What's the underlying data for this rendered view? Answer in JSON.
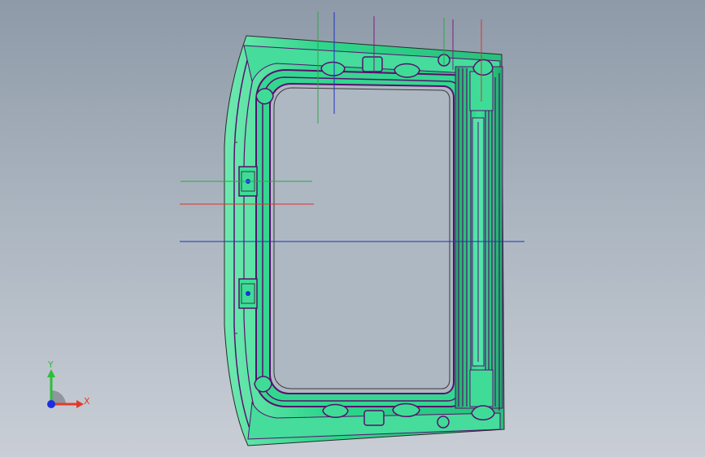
{
  "viewport": {
    "name": "3d-model-viewport",
    "background_top": "#8e9aa8",
    "background_bottom": "#c9ced6"
  },
  "model": {
    "name": "window-frame-part",
    "body_color": "#2fd68c",
    "body_light_color": "#6fe8b0",
    "edge_color": "#5a0f6e",
    "outline_color": "#2a2a2a"
  },
  "reference_lines": {
    "x_axis_color": "#e03030",
    "y_axis_color": "#2aa84a",
    "z_axis_color": "#2030c0",
    "extra_color": "#7a2080"
  },
  "triad": {
    "y_label": "Y",
    "x_label": "X",
    "y_color": "#2bbf3a",
    "x_color": "#e23a2a",
    "z_color": "#1b2ee0",
    "icon": "coordinate-triad-icon"
  }
}
